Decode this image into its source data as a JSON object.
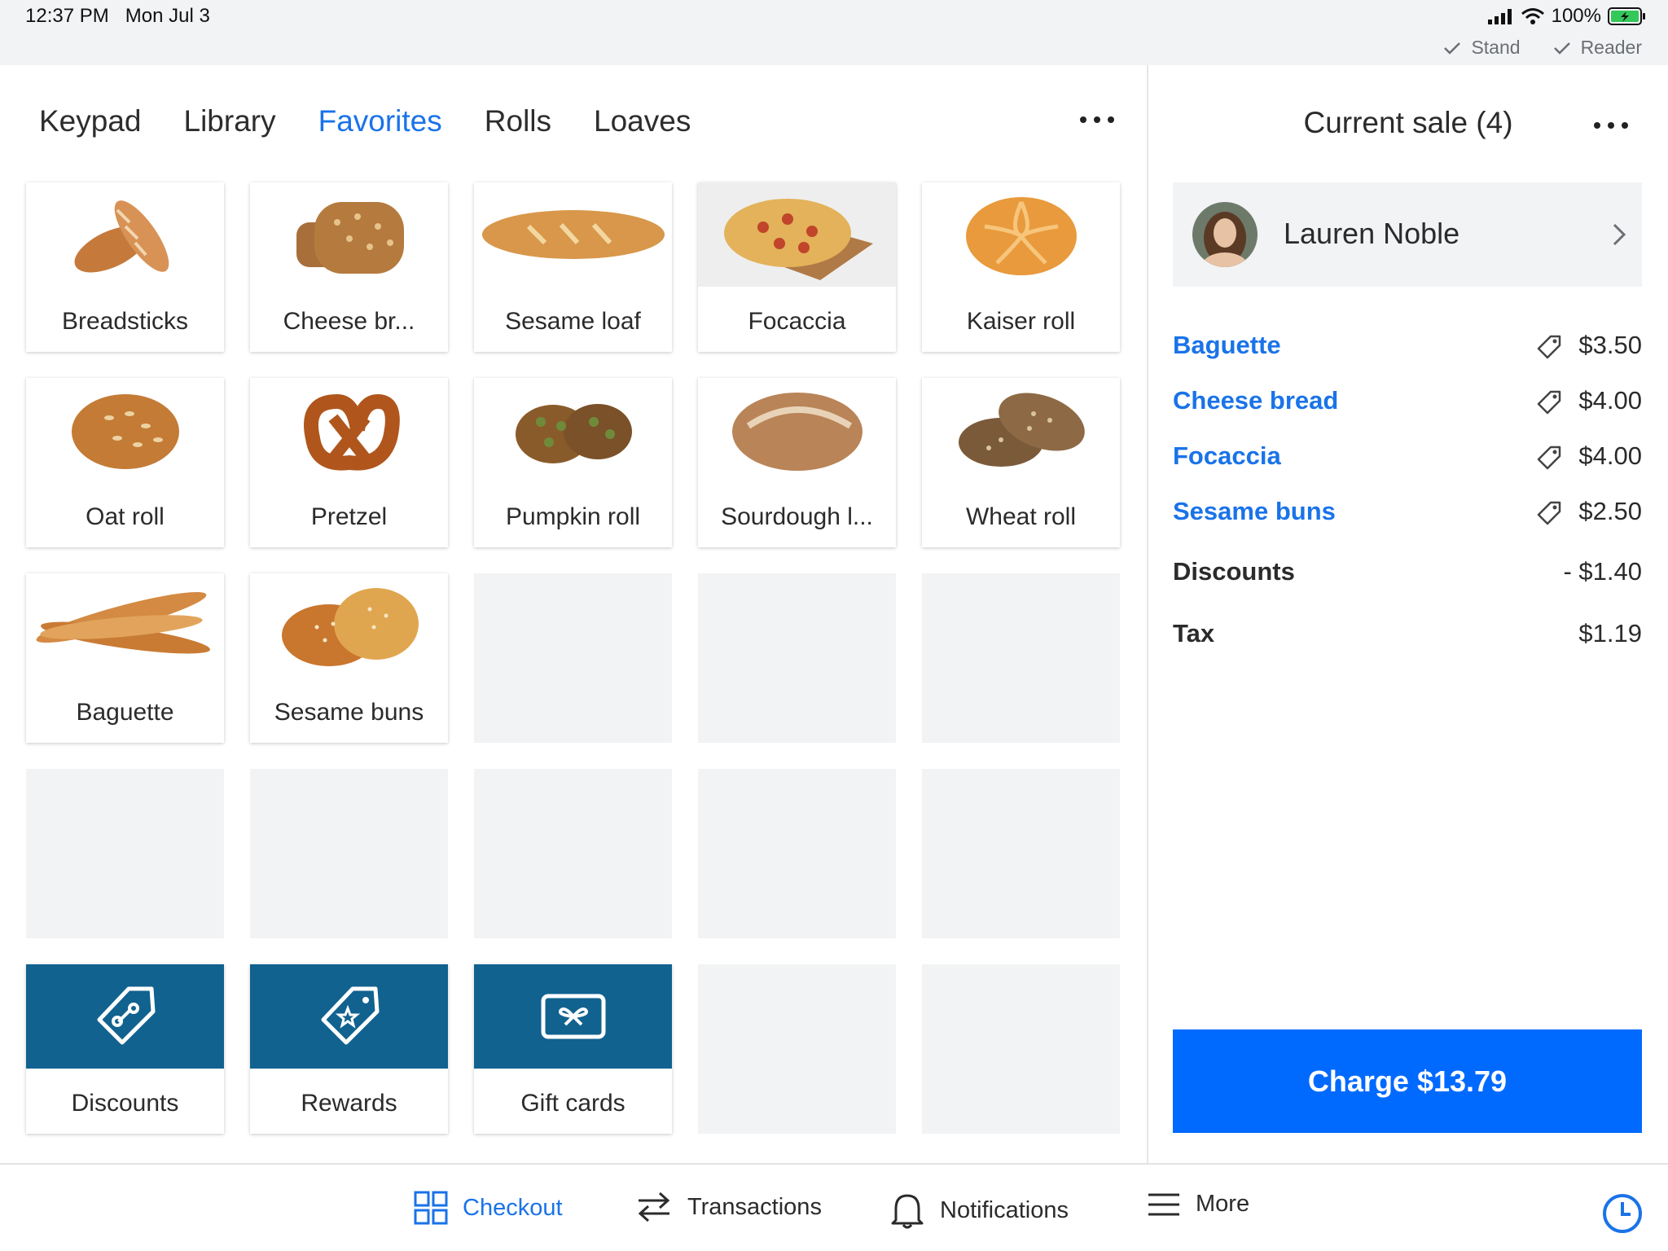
{
  "status_bar": {
    "time": "12:37 PM",
    "date": "Mon Jul 3",
    "battery": "100%",
    "checks": [
      "Stand",
      "Reader"
    ]
  },
  "tabs": [
    {
      "label": "Keypad",
      "active": false
    },
    {
      "label": "Library",
      "active": false
    },
    {
      "label": "Favorites",
      "active": true
    },
    {
      "label": "Rolls",
      "active": false
    },
    {
      "label": "Loaves",
      "active": false
    }
  ],
  "tiles": [
    {
      "label": "Breadsticks",
      "icon": "breadsticks-image"
    },
    {
      "label": "Cheese br...",
      "icon": "cheese-bread-image"
    },
    {
      "label": "Sesame loaf",
      "icon": "sesame-loaf-image"
    },
    {
      "label": "Focaccia",
      "icon": "focaccia-image"
    },
    {
      "label": "Kaiser roll",
      "icon": "kaiser-roll-image"
    },
    {
      "label": "Oat roll",
      "icon": "oat-roll-image"
    },
    {
      "label": "Pretzel",
      "icon": "pretzel-image"
    },
    {
      "label": "Pumpkin roll",
      "icon": "pumpkin-roll-image"
    },
    {
      "label": "Sourdough l...",
      "icon": "sourdough-loaf-image"
    },
    {
      "label": "Wheat roll",
      "icon": "wheat-roll-image"
    },
    {
      "label": "Baguette",
      "icon": "baguette-image"
    },
    {
      "label": "Sesame buns",
      "icon": "sesame-buns-image"
    }
  ],
  "actions": [
    {
      "label": "Discounts",
      "icon": "discount-tag-icon"
    },
    {
      "label": "Rewards",
      "icon": "reward-star-tag-icon"
    },
    {
      "label": "Gift cards",
      "icon": "gift-card-icon"
    }
  ],
  "sale": {
    "title": "Current sale (4)",
    "customer": "Lauren Noble",
    "items": [
      {
        "name": "Baguette",
        "price": "$3.50"
      },
      {
        "name": "Cheese bread",
        "price": "$4.00"
      },
      {
        "name": "Focaccia",
        "price": "$4.00"
      },
      {
        "name": "Sesame buns",
        "price": "$2.50"
      }
    ],
    "discounts_label": "Discounts",
    "discounts_value": "- $1.40",
    "tax_label": "Tax",
    "tax_value": "$1.19",
    "charge_label": "Charge $13.79"
  },
  "bottom_nav": [
    {
      "label": "Checkout",
      "active": true
    },
    {
      "label": "Transactions",
      "active": false
    },
    {
      "label": "Notifications",
      "active": false
    },
    {
      "label": "More",
      "active": false
    }
  ],
  "colors": {
    "accent_blue": "#1a73e8",
    "charge_blue": "#006aff",
    "action_tile": "#11628f"
  }
}
